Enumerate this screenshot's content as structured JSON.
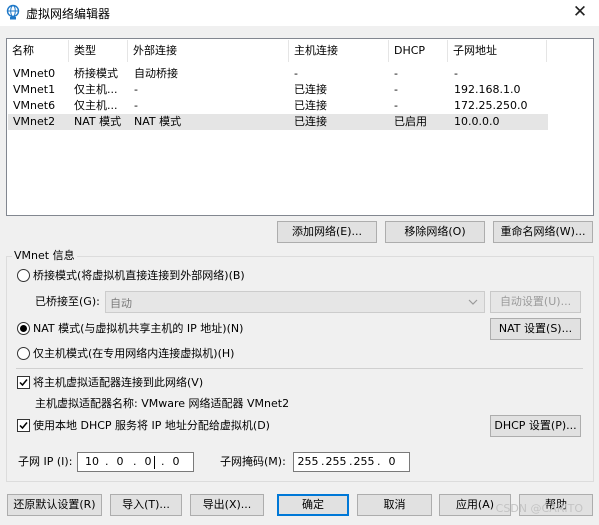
{
  "window": {
    "title": "虚拟网络编辑器",
    "close_glyph": "✕"
  },
  "list": {
    "columns": [
      "名称",
      "类型",
      "外部连接",
      "主机连接",
      "DHCP",
      "子网地址"
    ],
    "rows": [
      [
        "VMnet0",
        "桥接模式",
        "自动桥接",
        "-",
        "-",
        "-"
      ],
      [
        "VMnet1",
        "仅主机...",
        "-",
        "已连接",
        "-",
        "192.168.1.0"
      ],
      [
        "VMnet6",
        "仅主机...",
        "-",
        "已连接",
        "-",
        "172.25.250.0"
      ],
      [
        "VMnet2",
        "NAT 模式",
        "NAT 模式",
        "已连接",
        "已启用",
        "10.0.0.0"
      ]
    ],
    "selected_row": 3
  },
  "list_buttons": {
    "add": "添加网络(E)...",
    "remove": "移除网络(O)",
    "rename": "重命名网络(W)..."
  },
  "vmnet_info": {
    "group_label": "VMnet 信息",
    "bridged_label": "桥接模式(将虚拟机直接连接到外部网络)(B)",
    "bridged_to_label": "已桥接至(G):",
    "bridged_to_value": "自动",
    "auto_settings_button": "自动设置(U)...",
    "nat_label": "NAT 模式(与虚拟机共享主机的 IP 地址)(N)",
    "nat_settings_button": "NAT 设置(S)...",
    "hostonly_label": "仅主机模式(在专用网络内连接虚拟机)(H)",
    "selected_mode": "nat",
    "connect_adapter_label": "将主机虚拟适配器连接到此网络(V)",
    "connect_adapter_checked": true,
    "adapter_name_text": "主机虚拟适配器名称: VMware 网络适配器 VMnet2",
    "dhcp_label": "使用本地 DHCP 服务将 IP 地址分配给虚拟机(D)",
    "dhcp_checked": true,
    "dhcp_settings_button": "DHCP 设置(P)...",
    "subnet_ip_label": "子网 IP (I):",
    "subnet_ip": [
      "10",
      "0",
      "0",
      "0"
    ],
    "subnet_mask_label": "子网掩码(M):",
    "subnet_mask": [
      "255",
      "255",
      "255",
      "0"
    ]
  },
  "bottom_buttons": {
    "restore": "还原默认设置(R)",
    "import": "导入(T)...",
    "export": "导出(X)...",
    "ok": "确定",
    "cancel": "取消",
    "apply": "应用(A)",
    "help": "帮助"
  },
  "watermark": "CSDN @CARITO",
  "colors": {
    "focus_border": "#0078d7",
    "selected_row": "#e5e5e5"
  }
}
